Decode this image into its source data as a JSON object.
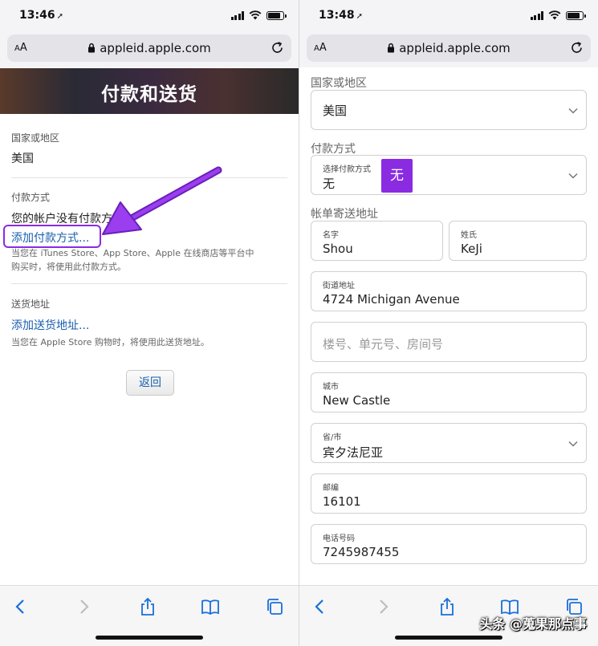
{
  "left": {
    "status": {
      "time": "13:46"
    },
    "url": {
      "aa_small": "A",
      "aa_big": "A",
      "domain": "appleid.apple.com"
    },
    "hero_title": "付款和送货",
    "country": {
      "label": "国家或地区",
      "value": "美国"
    },
    "payment": {
      "label": "付款方式",
      "no_payment_text": "您的帐户没有付款方式。",
      "add_link": "添加付款方式...",
      "note_line1": "当您在 iTunes Store、App Store、Apple 在线商店等平台中",
      "note_line2": "购买时，将使用此付款方式。"
    },
    "shipping": {
      "label": "送货地址",
      "add_link": "添加送货地址...",
      "note": "当您在 Apple Store 购物时，将使用此送货地址。"
    },
    "back_button": "返回",
    "annotation_color": "#8a2be2"
  },
  "right": {
    "status": {
      "time": "13:48"
    },
    "url": {
      "aa_small": "A",
      "aa_big": "A",
      "domain": "appleid.apple.com"
    },
    "country_label": "国家或地区",
    "country_value": "美国",
    "payment_label": "付款方式",
    "payment_select_caption": "选择付款方式",
    "payment_select_value": "无",
    "highlight_badge": "无",
    "billing_label": "帐单寄送地址",
    "first_name_caption": "名字",
    "first_name_value": "Shou",
    "last_name_caption": "姓氏",
    "last_name_value": "KeJi",
    "street_caption": "街道地址",
    "street_value": "4724 Michigan Avenue",
    "apt_placeholder": "楼号、单元号、房间号",
    "city_caption": "城市",
    "city_value": "New Castle",
    "state_caption": "省/市",
    "state_value": "宾夕法尼亚",
    "zip_caption": "邮编",
    "zip_value": "16101",
    "phone_caption": "电话号码",
    "phone_value": "7245987455"
  },
  "watermark": "头条 @蒐果那点事",
  "colors": {
    "link": "#1a5fae",
    "accent": "#8a2be2",
    "toolbar_icon": "#1a6fd8"
  }
}
